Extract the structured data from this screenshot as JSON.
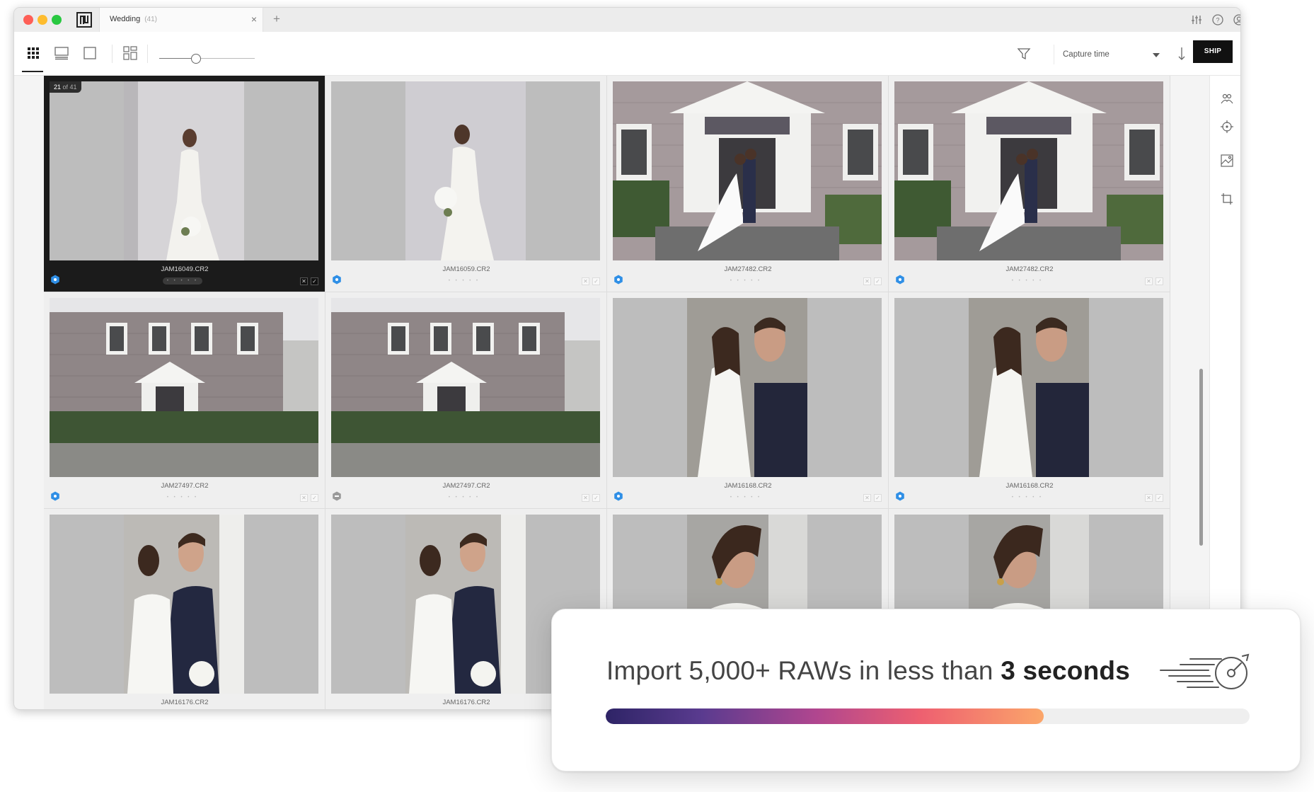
{
  "app": {
    "tab_title": "Wedding",
    "tab_count": "(41)",
    "tab_close": "×",
    "tab_add": "+"
  },
  "toolbar": {
    "sort_label": "Capture time",
    "ship_label": "SHIP",
    "thumbnail_size": 0.3
  },
  "grid": {
    "counter_current": "21",
    "counter_total": "of 41",
    "rating_dots": "• • • • •",
    "reject_mark": "✕",
    "pick_mark": "✓",
    "items": [
      {
        "filename": "JAM16049.CR2",
        "selected": true,
        "badge": "blue"
      },
      {
        "filename": "JAM16059.CR2",
        "selected": false,
        "badge": "blue"
      },
      {
        "filename": "JAM27482.CR2",
        "selected": false,
        "badge": "blue"
      },
      {
        "filename": "JAM27482.CR2",
        "selected": false,
        "badge": "blue"
      },
      {
        "filename": "JAM27497.CR2",
        "selected": false,
        "badge": "blue"
      },
      {
        "filename": "JAM27497.CR2",
        "selected": false,
        "badge": "gray"
      },
      {
        "filename": "JAM16168.CR2",
        "selected": false,
        "badge": "blue"
      },
      {
        "filename": "JAM16168.CR2",
        "selected": false,
        "badge": "blue"
      },
      {
        "filename": "JAM16176.CR2",
        "selected": false,
        "badge": "none"
      },
      {
        "filename": "JAM16176.CR2",
        "selected": false,
        "badge": "none"
      }
    ]
  },
  "overlay": {
    "text_prefix": "Import 5,000+ RAWs in less than ",
    "text_bold": "3 seconds",
    "progress": 0.68
  },
  "colors": {
    "badge_blue": "#2f8fe6",
    "badge_gray": "#9a9a9a",
    "ship_bg": "#111111",
    "progress_start": "#2e2466",
    "progress_end": "#fba66a"
  },
  "icons": {
    "left_tools": [
      "grid-view-icon",
      "filmstrip-view-icon",
      "single-view-icon",
      "compare-view-icon"
    ],
    "right_titlebar": [
      "adjust-sliders-icon",
      "help-icon",
      "account-icon"
    ],
    "right_panel": [
      "faces-icon",
      "target-icon",
      "image-adjust-icon",
      "crop-icon"
    ],
    "sort": [
      "filter-icon",
      "sort-direction-icon"
    ]
  }
}
